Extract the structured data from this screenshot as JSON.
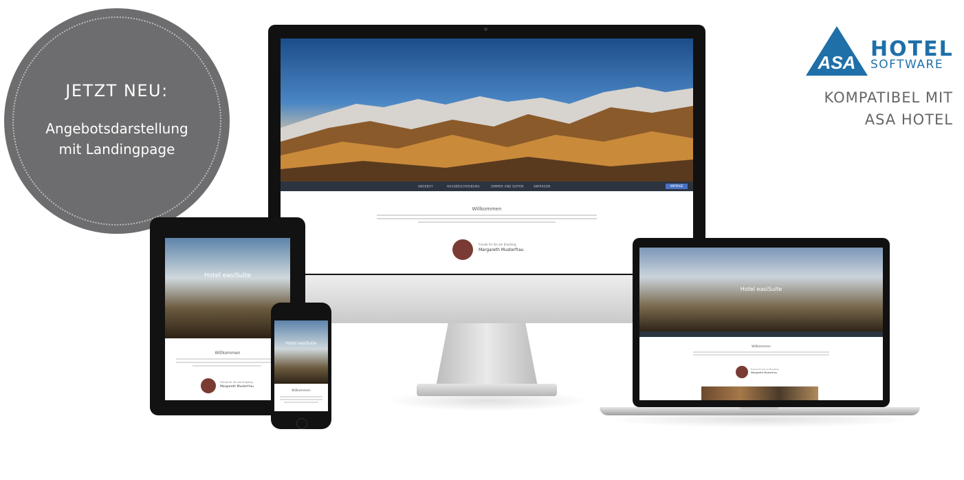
{
  "badge": {
    "title": "JETZT NEU:",
    "subtitle_line1": "Angebotsdarstellung",
    "subtitle_line2": "mit Landingpage"
  },
  "logo": {
    "mark": "ASA",
    "word": "HOTEL",
    "subword": "SOFTWARE",
    "tagline_line1": "KOMPATIBEL MIT",
    "tagline_line2": "ASA HOTEL",
    "color": "#1f6fa8"
  },
  "desktop_site": {
    "nav": [
      "ANGEBOT",
      "HAUSBESCHREIBUNG",
      "ZIMMER UND SUITEN",
      "ANFRAGEN"
    ],
    "cta": "ANFRAGE",
    "welcome": "Willkommen",
    "greeting": "Freude für Sie am Empfang",
    "host_name": "Margareth Musterfrau"
  },
  "tablet_site": {
    "hero_title": "Hotel easiSuite",
    "welcome": "Willkommen",
    "greeting": "Freude für Sie am Empfang",
    "host_name": "Margareth Musterfrau"
  },
  "phone_site": {
    "hero_title": "Hotel easiSuite",
    "welcome": "Willkommen"
  },
  "laptop_site": {
    "hero_title": "Hotel easiSuite",
    "welcome": "Willkommen",
    "greeting": "Freude für Sie am Empfang",
    "host_name": "Margareth Musterfrau"
  }
}
